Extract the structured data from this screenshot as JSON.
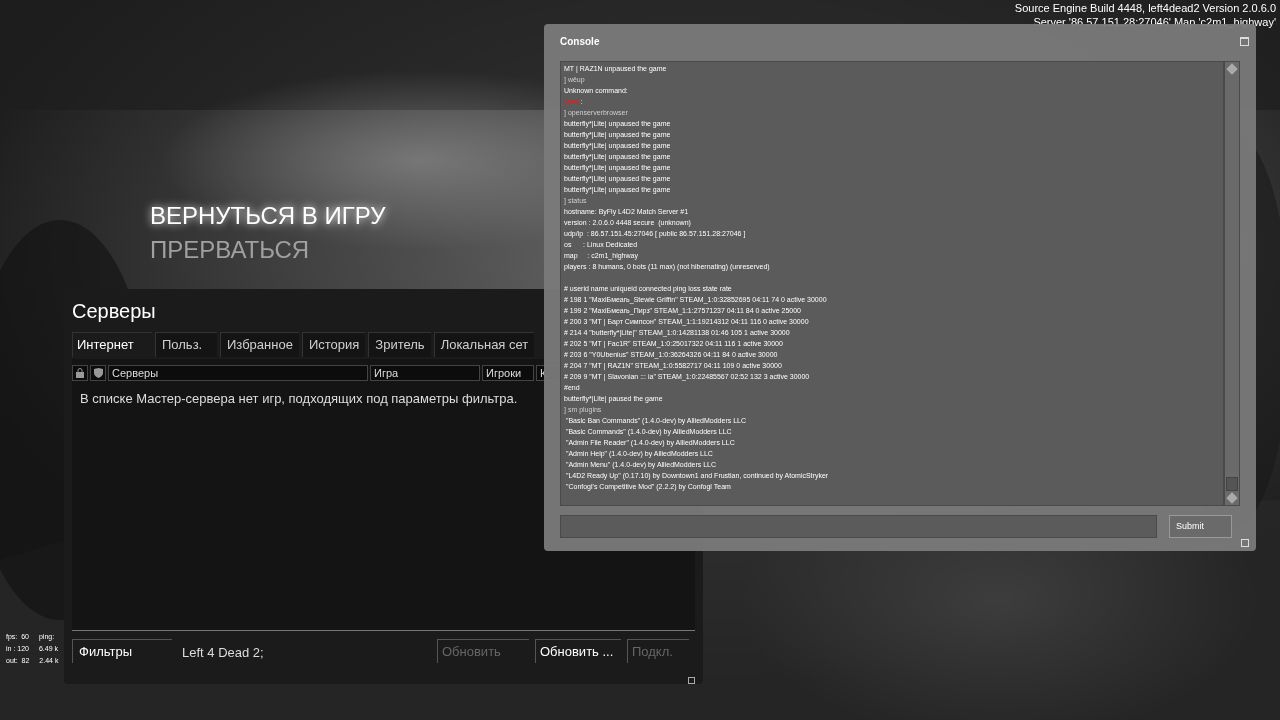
{
  "engine_info": [
    "Source Engine Build 4448, left4dead2 Version 2.0.6.0",
    "Server '86.57.151.28:27046' Map 'c2m1_highway'"
  ],
  "main_menu": [
    {
      "label": "ВЕРНУТЬСЯ В ИГРУ",
      "selected": true
    },
    {
      "label": "ПРЕРВАТЬСЯ",
      "selected": false
    }
  ],
  "net_graph": [
    [
      "fps:  60",
      "ping:"
    ],
    [
      "in : 120",
      "6.49 k"
    ],
    [
      "out:  82",
      "2.44 k"
    ]
  ],
  "console": {
    "title": "Console",
    "submit": "Submit",
    "lines": [
      {
        "kind": "normal",
        "text": "MT | RAZ1N unpaused the game"
      },
      {
        "kind": "echo",
        "text": "] wёup"
      },
      {
        "kind": "normal",
        "text": "Unknown command:"
      },
      {
        "kind": "error",
        "label": "Maxi",
        "text": " :"
      },
      {
        "kind": "echo",
        "text": "] openserverbrowser"
      },
      {
        "kind": "normal",
        "text": "butterfly*|Lite| unpaused the game"
      },
      {
        "kind": "normal",
        "text": "butterfly*|Lite| unpaused the game"
      },
      {
        "kind": "normal",
        "text": "butterfly*|Lite| unpaused the game"
      },
      {
        "kind": "normal",
        "text": "butterfly*|Lite| unpaused the game"
      },
      {
        "kind": "normal",
        "text": "butterfly*|Lite| unpaused the game"
      },
      {
        "kind": "normal",
        "text": "butterfly*|Lite| unpaused the game"
      },
      {
        "kind": "normal",
        "text": "butterfly*|Lite| unpaused the game"
      },
      {
        "kind": "echo",
        "text": "] status"
      },
      {
        "kind": "normal",
        "text": "hostname: ByFly L4D2 Match Server #1"
      },
      {
        "kind": "normal",
        "text": "version : 2.0.6.0 4448 secure  (unknown)"
      },
      {
        "kind": "normal",
        "text": "udp/ip  : 86.57.151.45:27046 [ public 86.57.151.28:27046 ]"
      },
      {
        "kind": "normal",
        "text": "os      : Linux Dedicated"
      },
      {
        "kind": "normal",
        "text": "map     : c2m1_highway"
      },
      {
        "kind": "normal",
        "text": "players : 8 humans, 0 bots (11 max) (not hibernating) (unreserved)"
      },
      {
        "kind": "blank"
      },
      {
        "kind": "normal",
        "text": "# userid name uniqueid connected ping loss state rate"
      },
      {
        "kind": "normal",
        "text": "# 198 1 \"MaxiБмеаrь_Stewie Griffin\" STEAM_1:0:32852695 04:11 74 0 active 30000"
      },
      {
        "kind": "normal",
        "text": "# 199 2 \"MaxiБмеаrь_Пирз\" STEAM_1:1:27571237 04:11 84 0 active 25000"
      },
      {
        "kind": "normal",
        "text": "# 200 3 \"MT | Барт Симпсон\" STEAM_1:1:19214312 04:11 116 0 active 30000"
      },
      {
        "kind": "normal",
        "text": "# 214 4 \"butterfly*|Lite|\" STEAM_1:0:14281138 01:46 105 1 active 30000"
      },
      {
        "kind": "normal",
        "text": "# 202 5 \"MT | Fac1R\" STEAM_1:0:25017322 04:11 116 1 active 30000"
      },
      {
        "kind": "normal",
        "text": "# 203 6 \"Y0Ubenius\" STEAM_1:0:36264326 04:11 84 0 active 30000"
      },
      {
        "kind": "normal",
        "text": "# 204 7 \"MT | RAZ1N\" STEAM_1:0:5582717 04:11 109 0 active 30000"
      },
      {
        "kind": "normal",
        "text": "# 209 9 \"MT | Slavonian ::: ia\" STEAM_1:0:22485567 02:52 132 3 active 30000"
      },
      {
        "kind": "normal",
        "text": "#end"
      },
      {
        "kind": "normal",
        "text": "butterfly*|Lite| paused the game"
      },
      {
        "kind": "echo",
        "text": "] sm plugins"
      },
      {
        "kind": "normal",
        "text": " \"Basic Ban Commands\" (1.4.0-dev) by AlliedModders LLC"
      },
      {
        "kind": "normal",
        "text": " \"Basic Commands\" (1.4.0-dev) by AlliedModders LLC"
      },
      {
        "kind": "normal",
        "text": " \"Admin File Reader\" (1.4.0-dev) by AlliedModders LLC"
      },
      {
        "kind": "normal",
        "text": " \"Admin Help\" (1.4.0-dev) by AlliedModders LLC"
      },
      {
        "kind": "normal",
        "text": " \"Admin Menu\" (1.4.0-dev) by AlliedModders LLC"
      },
      {
        "kind": "normal",
        "text": " \"L4D2 Ready Up\" (0.17.10) by Downtown1 and Frustian, continued by AtomicStryker"
      },
      {
        "kind": "normal",
        "text": " \"Confogl's Competitive Mod\" (2.2.2) by Confogl Team"
      }
    ]
  },
  "servers": {
    "title": "Серверы",
    "tabs": [
      {
        "label": "Интернет",
        "selected": true
      },
      {
        "label": "Польз.",
        "selected": false
      },
      {
        "label": "Избранное",
        "selected": false
      },
      {
        "label": "История",
        "selected": false
      },
      {
        "label": "Зритель",
        "selected": false
      },
      {
        "label": "Локальная сет",
        "selected": false
      }
    ],
    "columns": [
      "Серверы",
      "Игра",
      "Игроки",
      "К"
    ],
    "message": "В списке Мастер-сервера нет игр, подходящих под параметры фильтра.",
    "filters_button": "Фильтры",
    "filter_summary": "Left 4 Dead 2;",
    "buttons": [
      {
        "label": "Обновить",
        "disabled": true
      },
      {
        "label": "Обновить ...",
        "disabled": false
      },
      {
        "label": "Подкл.",
        "disabled": true
      }
    ]
  }
}
